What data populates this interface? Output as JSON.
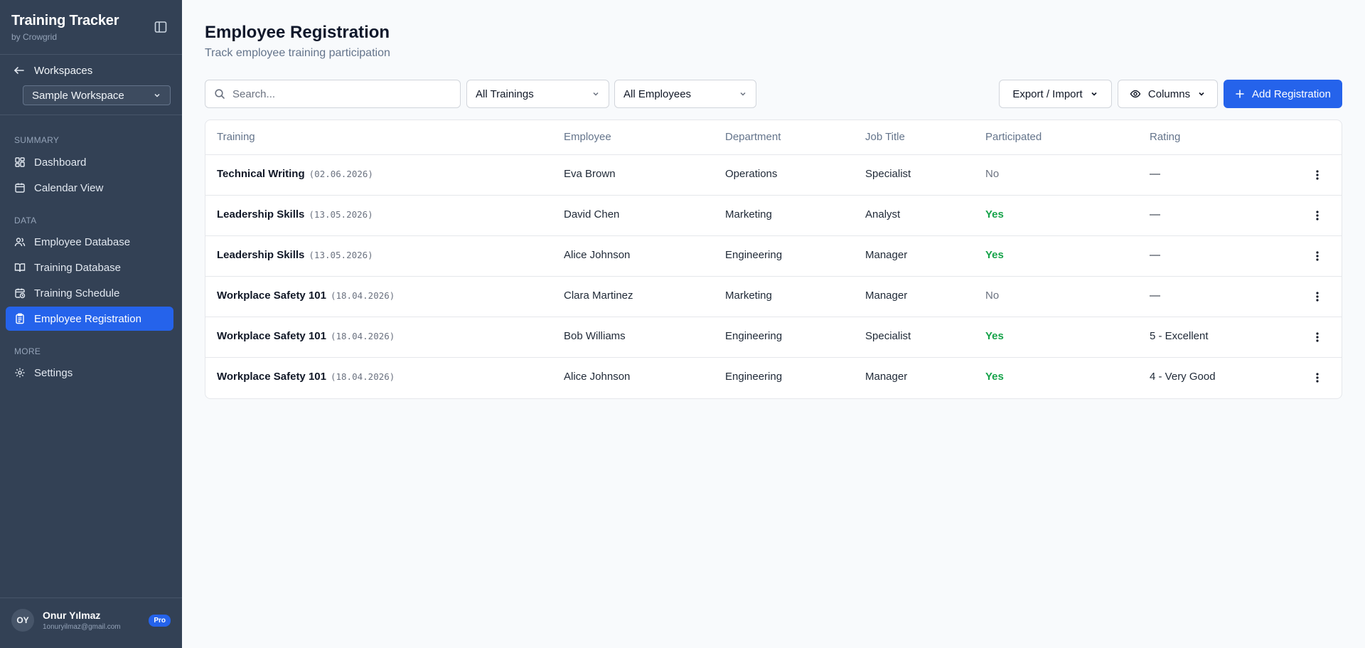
{
  "app": {
    "title": "Training Tracker",
    "subtitle": "by Crowgrid"
  },
  "sidebar": {
    "workspaces_label": "Workspaces",
    "workspace_selected": "Sample Workspace",
    "sections": {
      "summary": "SUMMARY",
      "data": "DATA",
      "more": "MORE"
    },
    "items": {
      "dashboard": "Dashboard",
      "calendar": "Calendar View",
      "employee_db": "Employee Database",
      "training_db": "Training Database",
      "training_schedule": "Training Schedule",
      "employee_registration": "Employee Registration",
      "settings": "Settings"
    },
    "user": {
      "initials": "OY",
      "name": "Onur Yılmaz",
      "email": "1onuryilmaz@gmail.com",
      "badge": "Pro"
    }
  },
  "header": {
    "title": "Employee Registration",
    "subtitle": "Track employee training participation"
  },
  "toolbar": {
    "search_placeholder": "Search...",
    "training_filter": "All Trainings",
    "employee_filter": "All Employees",
    "export_import": "Export / Import",
    "columns": "Columns",
    "add": "Add Registration"
  },
  "table": {
    "columns": [
      "Training",
      "Employee",
      "Department",
      "Job Title",
      "Participated",
      "Rating"
    ],
    "rows": [
      {
        "training": "Technical Writing",
        "date": "(02.06.2026)",
        "employee": "Eva Brown",
        "department": "Operations",
        "job_title": "Specialist",
        "participated": "No",
        "rating": "—"
      },
      {
        "training": "Leadership Skills",
        "date": "(13.05.2026)",
        "employee": "David Chen",
        "department": "Marketing",
        "job_title": "Analyst",
        "participated": "Yes",
        "rating": "—"
      },
      {
        "training": "Leadership Skills",
        "date": "(13.05.2026)",
        "employee": "Alice Johnson",
        "department": "Engineering",
        "job_title": "Manager",
        "participated": "Yes",
        "rating": "—"
      },
      {
        "training": "Workplace Safety 101",
        "date": "(18.04.2026)",
        "employee": "Clara Martinez",
        "department": "Marketing",
        "job_title": "Manager",
        "participated": "No",
        "rating": "—"
      },
      {
        "training": "Workplace Safety 101",
        "date": "(18.04.2026)",
        "employee": "Bob Williams",
        "department": "Engineering",
        "job_title": "Specialist",
        "participated": "Yes",
        "rating": "5 - Excellent"
      },
      {
        "training": "Workplace Safety 101",
        "date": "(18.04.2026)",
        "employee": "Alice Johnson",
        "department": "Engineering",
        "job_title": "Manager",
        "participated": "Yes",
        "rating": "4 - Very Good"
      }
    ]
  },
  "colors": {
    "sidebar_bg": "#334155",
    "accent": "#2563eb",
    "yes": "#16a34a",
    "no": "#6b7280"
  }
}
